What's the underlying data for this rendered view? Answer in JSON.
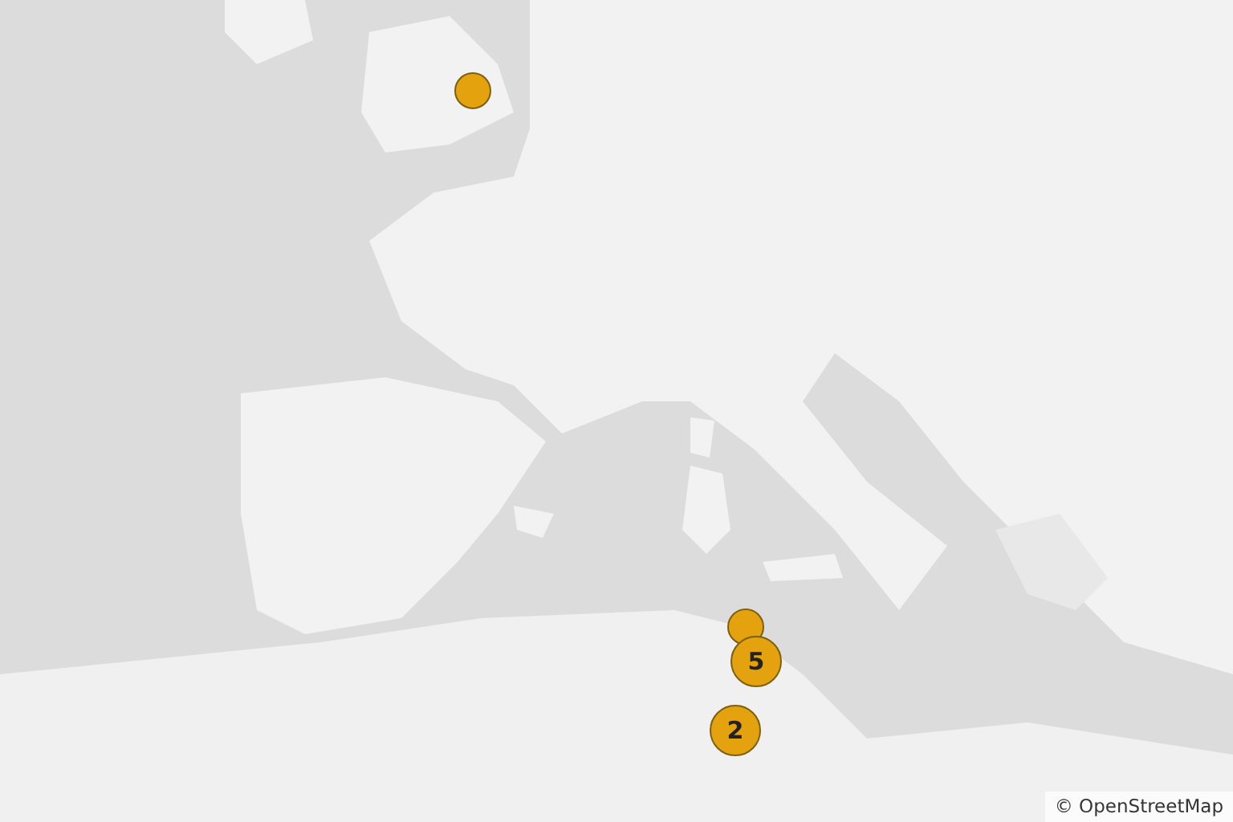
{
  "markers": [
    {
      "kind": "single"
    },
    {
      "kind": "single"
    },
    {
      "kind": "cluster",
      "count": "5"
    },
    {
      "kind": "cluster",
      "count": "2"
    }
  ],
  "attribution": "© OpenStreetMap"
}
